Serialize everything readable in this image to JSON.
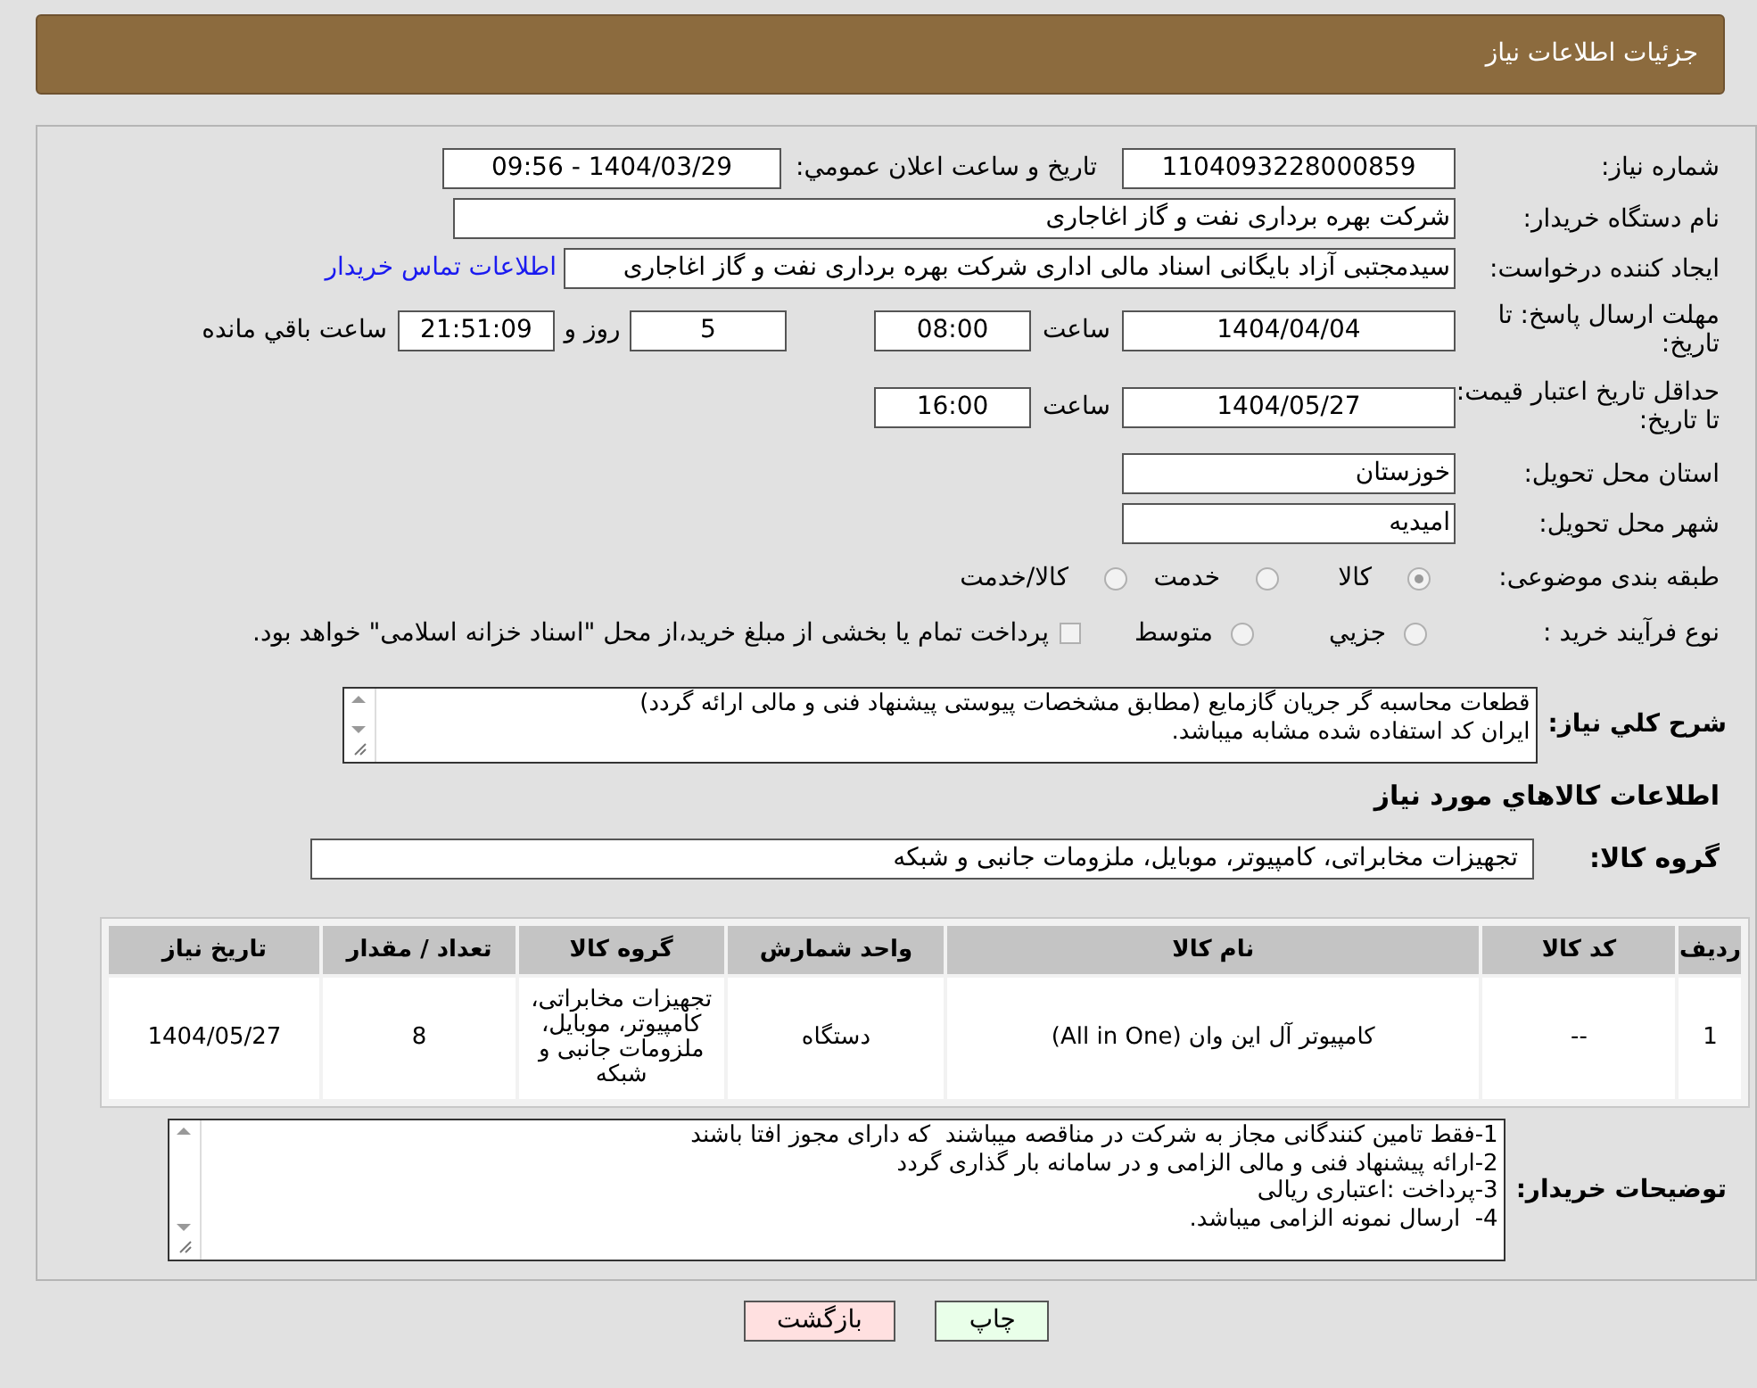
{
  "header": {
    "title": "جزئیات اطلاعات نیاز"
  },
  "need_number": {
    "label": "شماره نیاز:",
    "value": "1104093228000859"
  },
  "announce": {
    "label": "تاریخ و ساعت اعلان عمومي:",
    "value": "1404/03/29 - 09:56"
  },
  "buyer_org": {
    "label": "نام دستگاه خريدار:",
    "value": "شرکت بهره برداری نفت و گاز اغاجاری"
  },
  "requester": {
    "label": "ایجاد کننده درخواست:",
    "value": "سیدمجتبی آزاد بایگانی اسناد مالی اداری شرکت بهره برداری نفت و گاز اغاجاری",
    "link": "اطلاعات تماس خريدار"
  },
  "deadline": {
    "label": "مهلت ارسال پاسخ: تا تاریخ:",
    "date": "1404/04/04",
    "time_label": "ساعت",
    "time": "08:00",
    "days": "5",
    "days_label": "روز و",
    "remaining": "21:51:09",
    "remaining_label": "ساعت باقي مانده"
  },
  "validity": {
    "label": "حداقل تاریخ اعتبار قیمت: تا تاریخ:",
    "date": "1404/05/27",
    "time_label": "ساعت",
    "time": "16:00"
  },
  "province": {
    "label": "استان محل تحویل:",
    "value": "خوزستان"
  },
  "city": {
    "label": "شهر محل تحویل:",
    "value": "امیدیه"
  },
  "category": {
    "label": "طبقه بندی موضوعی:",
    "options": [
      {
        "label": "کالا",
        "selected": true
      },
      {
        "label": "خدمت",
        "selected": false
      },
      {
        "label": "کالا/خدمت",
        "selected": false
      }
    ]
  },
  "purchase_type": {
    "label": "نوع فرآیند خرید :",
    "options": [
      {
        "label": "جزيي",
        "selected": false
      },
      {
        "label": "متوسط",
        "selected": false
      }
    ],
    "payment": {
      "label": "پرداخت تمام یا بخشی از مبلغ خرید،از محل \"اسناد خزانه اسلامی\" خواهد بود.",
      "checked": false
    }
  },
  "description": {
    "label": "شرح کلي نیاز:",
    "lines": [
      "قطعات محاسبه گر جریان گازمایع (مطابق مشخصات پیوستی پیشنهاد فنی و مالی ارائه گردد)",
      "ایران کد استفاده شده مشابه میباشد."
    ]
  },
  "goods_title": "اطلاعات کالاهاي مورد نیاز",
  "goods_group": {
    "label": "گروه کالا:",
    "value": "تجهیزات مخابراتی، کامپیوتر، موبایل، ملزومات جانبی و شبکه"
  },
  "table": {
    "columns": [
      "ردیف",
      "کد کالا",
      "نام کالا",
      "واحد شمارش",
      "گروه کالا",
      "تعداد / مقدار",
      "تاریخ نیاز"
    ],
    "rows": [
      [
        "1",
        "--",
        "کامپیوتر آل این وان (All in One)",
        "دستگاه",
        "تجهیزات مخابراتی، کامپیوتر، موبایل، ملزومات جانبی و شبکه",
        "8",
        "1404/05/27"
      ]
    ]
  },
  "buyer_notes": {
    "label": "توضیحات خریدار:",
    "lines": [
      "1-فقط تامین کنندگانی مجاز به شرکت در مناقصه میباشند  که دارای مجوز افتا باشند",
      "2-ارائه پیشنهاد فنی و مالی الزامی و در سامانه بار گذاری گردد",
      "3-پرداخت :اعتباری ریالی",
      "4-  ارسال نمونه الزامی میباشد."
    ]
  },
  "buttons": [
    {
      "kind": "print",
      "label": "چاپ"
    },
    {
      "kind": "back",
      "label": "بازگشت"
    }
  ]
}
